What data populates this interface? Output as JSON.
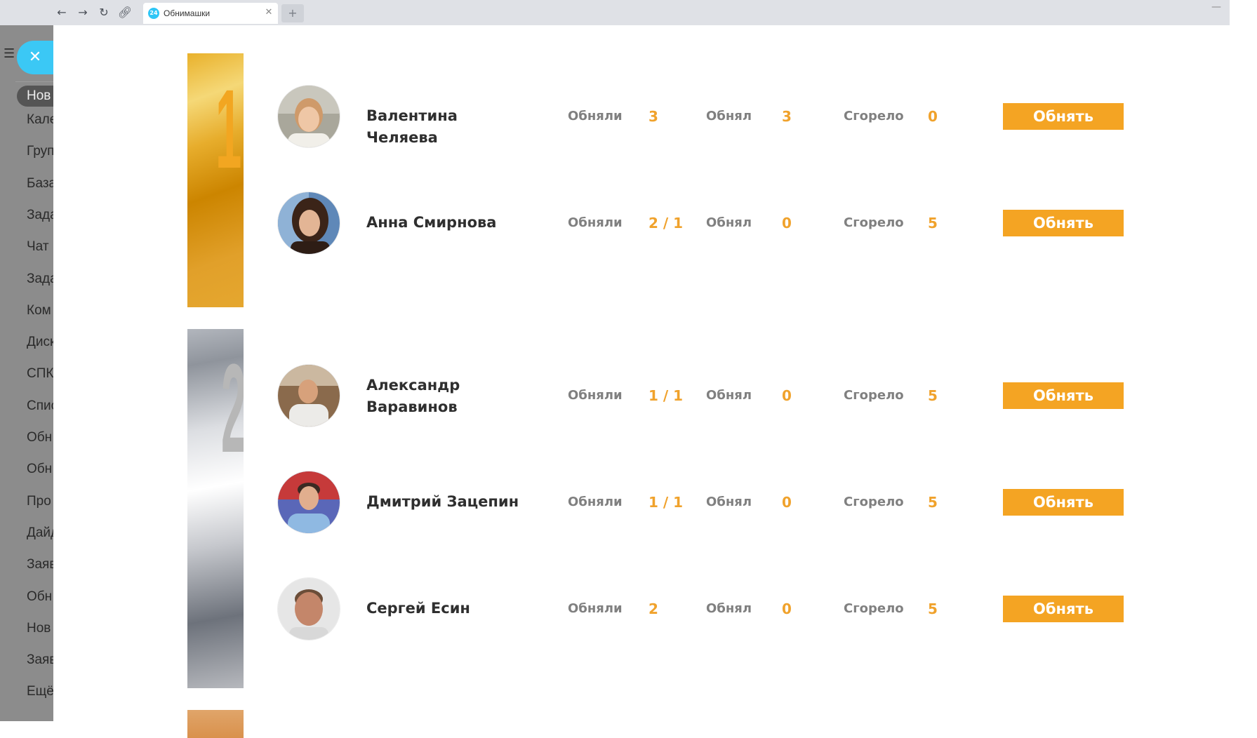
{
  "browser": {
    "tab_title": "Обнимашки",
    "tab_icon_text": "24"
  },
  "sidebar": {
    "items": [
      "Нов",
      "Кале",
      "Груп",
      "База",
      "Зада",
      "Чат",
      "Зада",
      "Ком",
      "Диск",
      "СПК",
      "Спис",
      "Обн",
      "Обн",
      "Про",
      "Дайд",
      "Заяв",
      "Обн",
      "Нов",
      "Заяв",
      "Ещё"
    ]
  },
  "labels": {
    "hugged_by": "Обняли",
    "hugged": "Обнял",
    "burned": "Сгорело",
    "button": "Обнять"
  },
  "ranks": [
    "1",
    "2"
  ],
  "rows": [
    {
      "name": "Валентина Челяева",
      "hugged_by": "3",
      "hugged": "3",
      "burned": "0"
    },
    {
      "name": "Анна Смирнова",
      "hugged_by": "2 / 1",
      "hugged": "0",
      "burned": "5"
    },
    {
      "name": "Александр Варавинов",
      "hugged_by": "1 / 1",
      "hugged": "0",
      "burned": "5"
    },
    {
      "name": "Дмитрий Зацепин",
      "hugged_by": "1 / 1",
      "hugged": "0",
      "burned": "5"
    },
    {
      "name": "Сергей Есин",
      "hugged_by": "2",
      "hugged": "0",
      "burned": "5"
    }
  ],
  "colors": {
    "accent": "#f4a423",
    "value": "#f0a22c",
    "gold": "#e7ad2c",
    "silver": "#c6c8cd",
    "sidebar_close": "#3bc8f5"
  }
}
